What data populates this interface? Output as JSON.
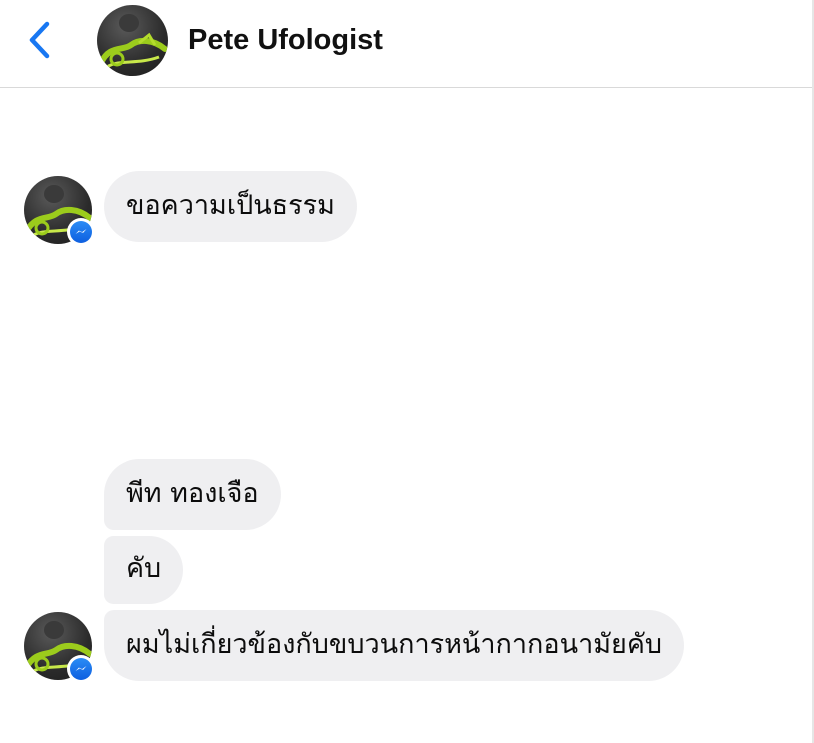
{
  "header": {
    "back_icon": "chevron-left-icon",
    "contact_name": "Pete Ufologist",
    "accent_color": "#1877f2"
  },
  "messages": [
    {
      "text": "ขอความเป็นธรรม"
    },
    {
      "text": "พีท ทองเจือ"
    },
    {
      "text": "คับ"
    },
    {
      "text": "ผมไม่เกี่ยวข้องกับขบวนการหน้ากากอนามัยคับ"
    }
  ],
  "badge": {
    "icon": "messenger-icon",
    "color": "#1877f2"
  },
  "bubble_color": "#efeff1"
}
